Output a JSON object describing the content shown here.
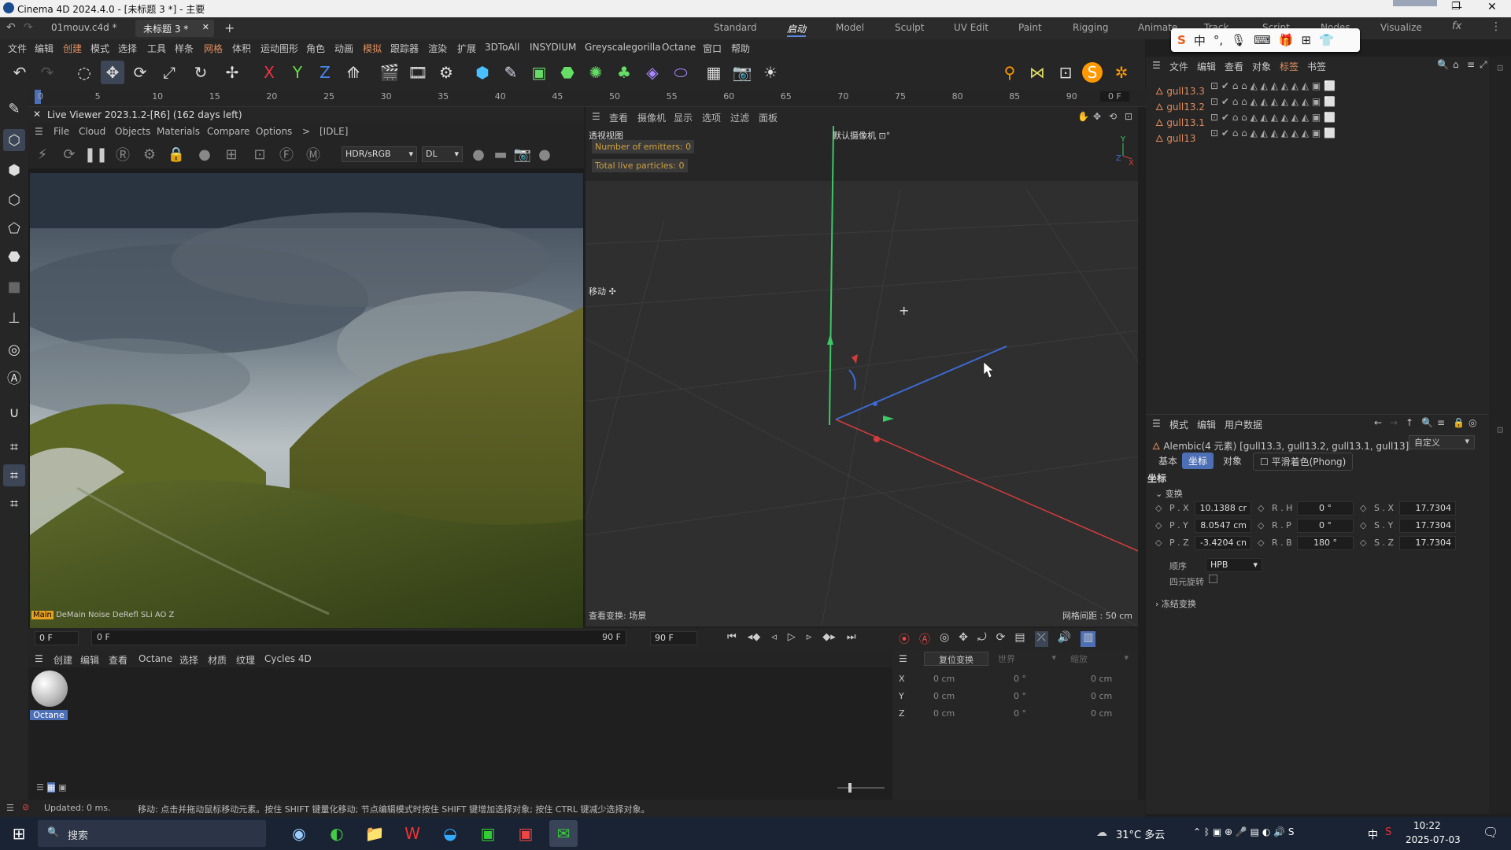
{
  "window": {
    "title": "Cinema 4D 2024.4.0 - [未标题 3 *] - 主要"
  },
  "tabs": [
    {
      "label": "01mouv.c4d *"
    },
    {
      "label": "未标题 3 *"
    }
  ],
  "layouts": [
    "Standard",
    "启动",
    "Model",
    "Sculpt",
    "UV Edit",
    "Paint",
    "Rigging",
    "Animate",
    "Track",
    "Script",
    "Nodes",
    "Visualize"
  ],
  "menu": [
    "文件",
    "编辑",
    "创建",
    "模式",
    "选择",
    "工具",
    "样条",
    "网格",
    "体积",
    "运动图形",
    "角色",
    "动画",
    "模拟",
    "跟踪器",
    "渲染",
    "扩展",
    "3DToAll",
    "INSYDIUM",
    "Greyscalegorilla",
    "Octane",
    "窗口",
    "帮助"
  ],
  "toolbar": {
    "axis_x": "X",
    "axis_y": "Y",
    "axis_z": "Z"
  },
  "ruler": {
    "ticks": [
      "0",
      "5",
      "10",
      "15",
      "20",
      "25",
      "30",
      "35",
      "40",
      "45",
      "50",
      "55",
      "60",
      "65",
      "70",
      "75",
      "80",
      "85",
      "90"
    ],
    "frame": "0 F"
  },
  "live_viewer": {
    "header": "Live Viewer 2023.1.2-[R6] (162 days left)",
    "menu": [
      "File",
      "Cloud",
      "Objects",
      "Materials",
      "Compare",
      "Options",
      ">",
      "[IDLE]"
    ],
    "color_mode": "HDR/sRGB",
    "render_mode": "DL",
    "status_tags": [
      "Main",
      "DeMain",
      "Noise",
      "DeRefl",
      "SLi",
      "AO",
      "Z"
    ]
  },
  "viewport": {
    "menu": [
      "查看",
      "摄像机",
      "显示",
      "选项",
      "过滤",
      "面板"
    ],
    "view_name": "透视视图",
    "camera": "默认摄像机 ⊡°",
    "emitters": "Number of emitters: 0",
    "particles": "Total live particles: 0",
    "move_label": "移动 ✣",
    "view_transform": "查看变换: 场景",
    "grid_spacing": "网格间距 : 50 cm"
  },
  "object_manager": {
    "menu": [
      "文件",
      "编辑",
      "查看",
      "对象",
      "标签",
      "书签"
    ],
    "objects": [
      {
        "name": "gull13.3"
      },
      {
        "name": "gull13.2"
      },
      {
        "name": "gull13.1"
      },
      {
        "name": "gull13"
      }
    ]
  },
  "attributes": {
    "menu": [
      "模式",
      "编辑",
      "用户数据"
    ],
    "title": "Alembic(4 元素) [gull13.3, gull13.2, gull13.1, gull13]",
    "preset": "自定义",
    "tabs": [
      "基本",
      "坐标",
      "对象",
      "平滑着色(Phong)"
    ],
    "section": "坐标",
    "group": "变换",
    "px": "10.1388 cr",
    "py": "8.0547 cm",
    "pz": "-3.4204 cn",
    "rh": "0 °",
    "rp": "0 °",
    "rb": "180 °",
    "sx": "17.7304",
    "sy": "17.7304",
    "sz": "17.7304",
    "labels": {
      "px": "P . X",
      "py": "P . Y",
      "pz": "P . Z",
      "rh": "R . H",
      "rp": "R . P",
      "rb": "R . B",
      "sx": "S . X",
      "sy": "S . Y",
      "sz": "S . Z"
    },
    "order_label": "顺序",
    "order_value": "HPB",
    "quat_label": "四元旋转",
    "freeze_label": "冻结变换"
  },
  "timeline": {
    "start": "0 F",
    "current": "0 F",
    "end": "90 F",
    "max": "90 F"
  },
  "material_manager": {
    "menu": [
      "创建",
      "编辑",
      "查看",
      "Octane",
      "选择",
      "材质",
      "纹理",
      "Cycles 4D"
    ],
    "material_name": "Octane"
  },
  "coordinates": {
    "reset_label": "复位变换",
    "world": "世界",
    "scale": "缩放",
    "rows": [
      {
        "axis": "X",
        "pos": "0 cm",
        "rot": "0 °",
        "size": "0 cm"
      },
      {
        "axis": "Y",
        "pos": "0 cm",
        "rot": "0 °",
        "size": "0 cm"
      },
      {
        "axis": "Z",
        "pos": "0 cm",
        "rot": "0 °",
        "size": "0 cm"
      }
    ]
  },
  "status": {
    "updated": "Updated: 0 ms.",
    "hint": "移动: 点击并拖动鼠标移动元素。按住 SHIFT 键量化移动; 节点编辑模式时按住 SHIFT 键增加选择对象; 按住 CTRL 键减少选择对象。"
  },
  "taskbar": {
    "search": "搜索",
    "weather": "31°C 多云",
    "time": "10:22",
    "date": "2025-07-03",
    "ime": "中"
  },
  "ime_toolbar": {
    "lang": "中"
  },
  "colors": {
    "accent": "#4d6fb5",
    "object_name": "#e08a5a",
    "x_axis": "#d23c3c",
    "y_axis": "#3cc864",
    "z_axis": "#3c6ad2"
  }
}
